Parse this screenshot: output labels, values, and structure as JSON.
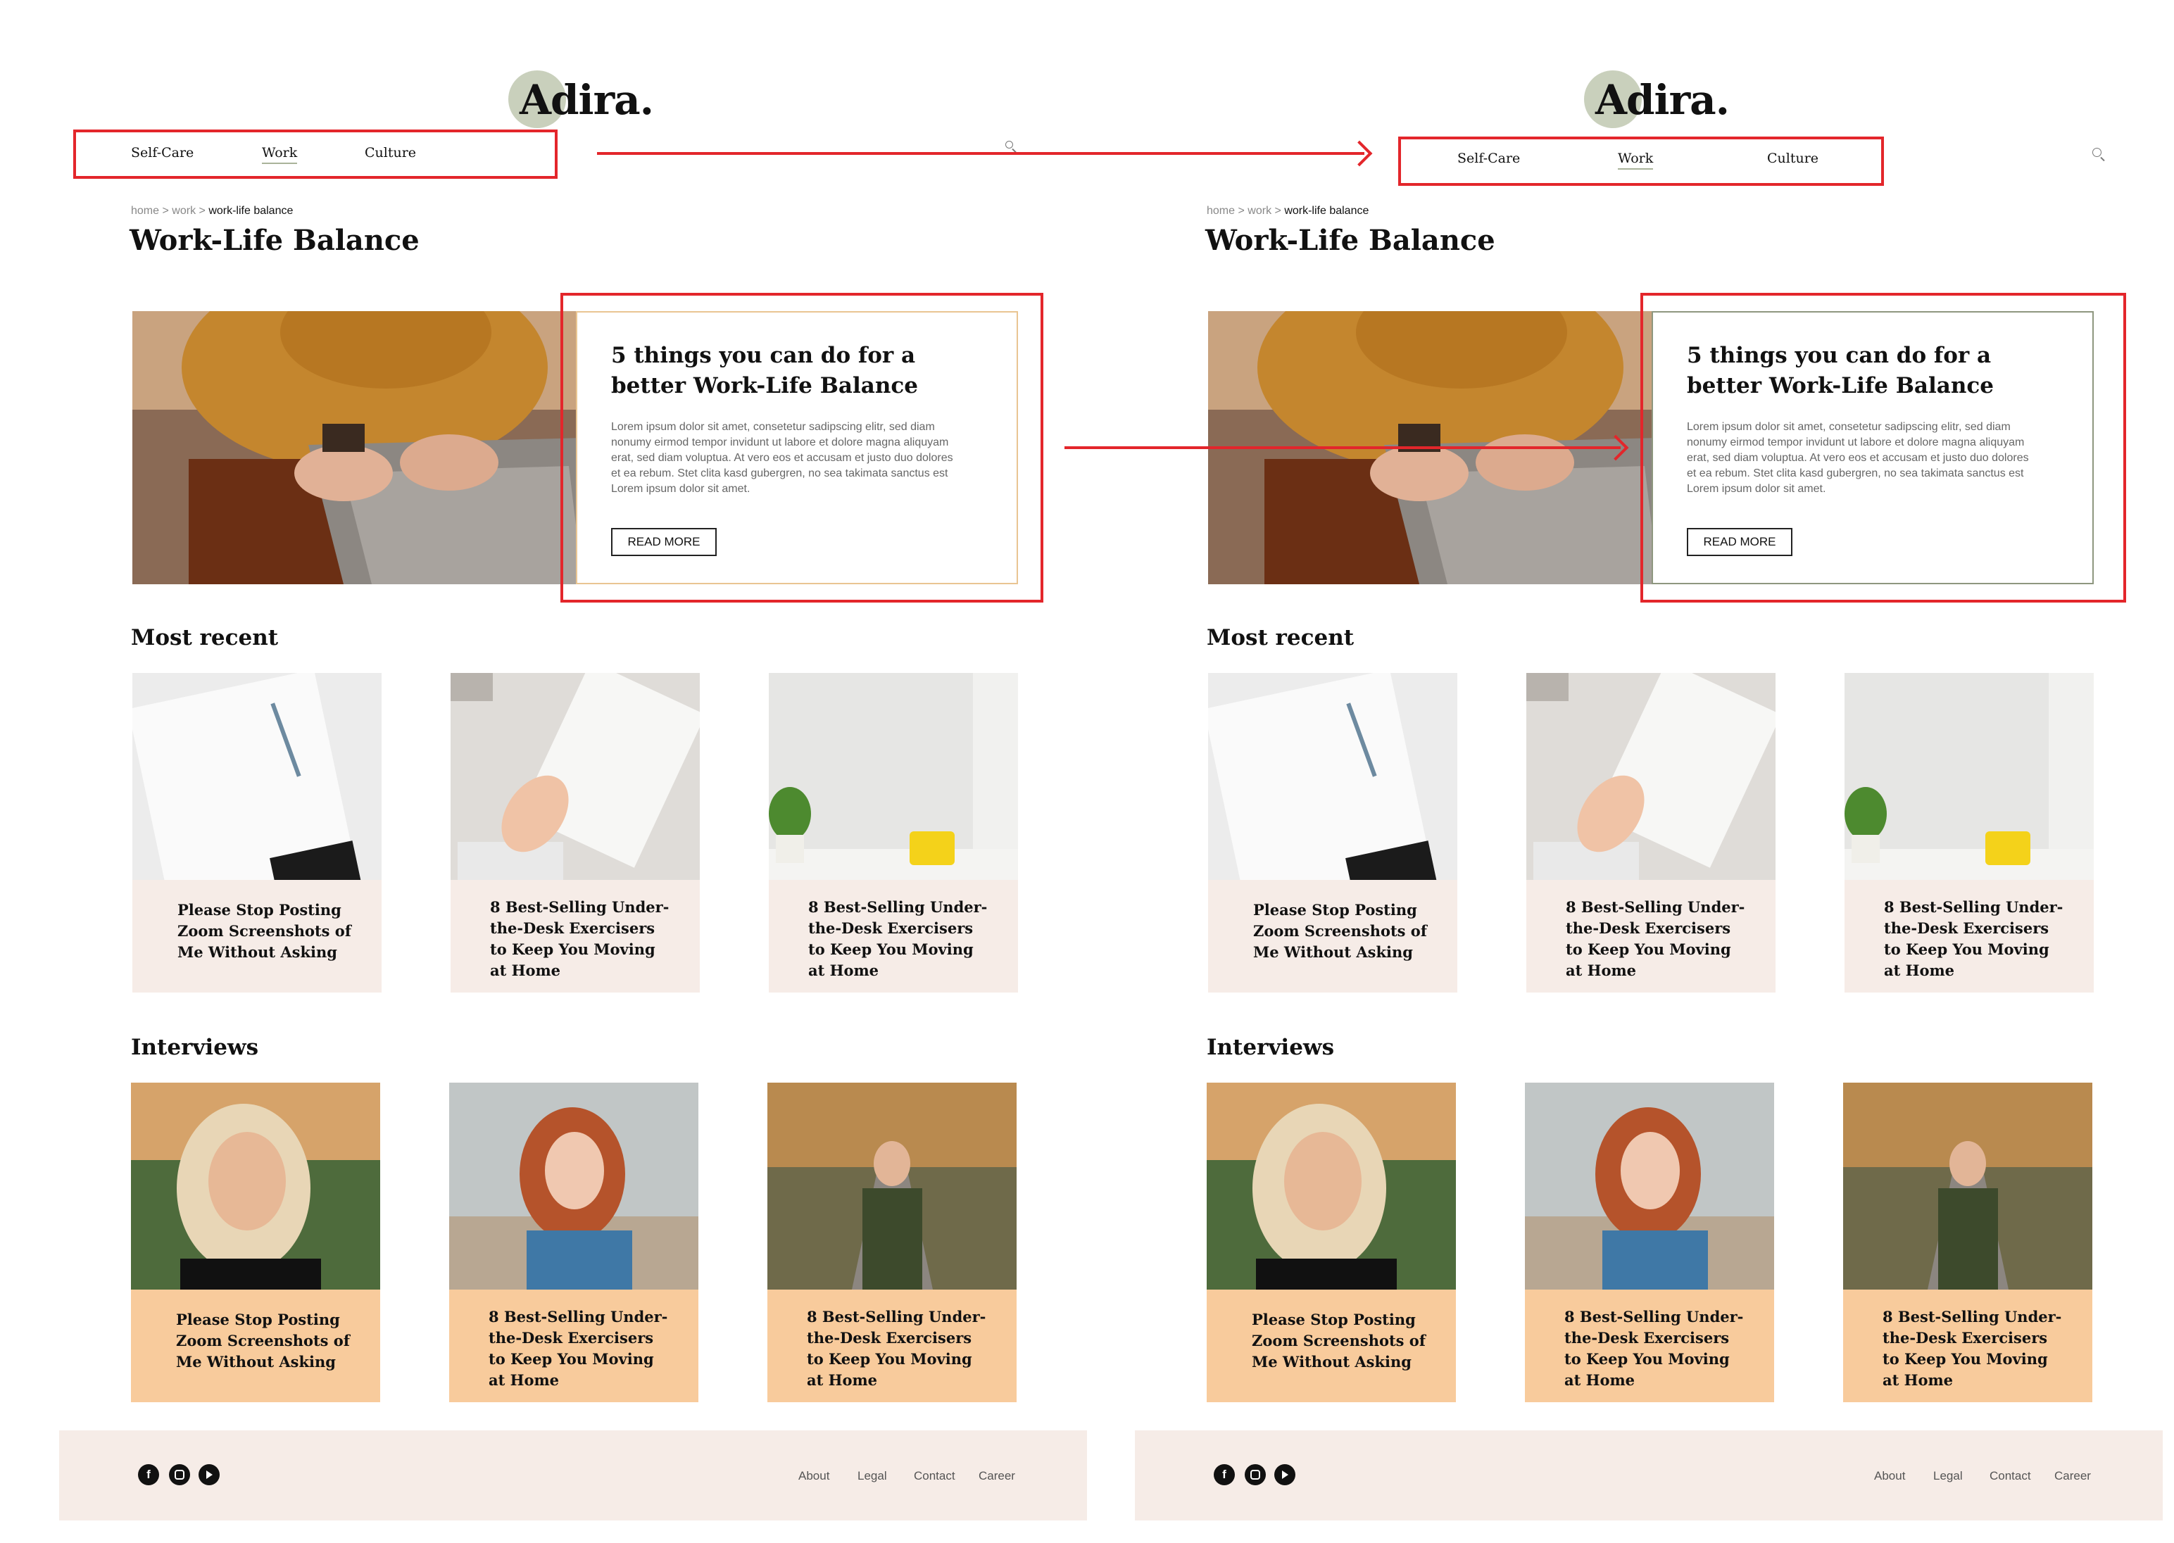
{
  "brand": {
    "logo": "Adira."
  },
  "nav": {
    "items": [
      "Self-Care",
      "Work",
      "Culture"
    ],
    "active": "Work"
  },
  "breadcrumb": {
    "home": "home",
    "sep": ">",
    "parent": "work",
    "current": "work-life balance"
  },
  "page": {
    "title": "Work-Life Balance"
  },
  "hero": {
    "title": "5 things you can do for a better Work-Life Balance",
    "body": "Lorem ipsum dolor sit amet, consetetur sadipscing elitr, sed diam nonumy eirmod tempor invidunt ut labore et dolore magna aliquyam erat, sed diam voluptua. At vero eos et accusam et justo duo dolores et ea rebum. Stet clita kasd gubergren, no sea takimata sanctus est Lorem ipsum dolor sit amet.",
    "button": "READ MORE"
  },
  "most_recent": {
    "title": "Most recent",
    "cards": [
      {
        "title": "Please Stop Posting Zoom Screenshots of Me Without Asking"
      },
      {
        "title": "8 Best-Selling Under-the-Desk Exercisers to Keep You Moving at Home"
      },
      {
        "title": "8 Best-Selling Under-the-Desk Exercisers to Keep You Moving at Home"
      }
    ]
  },
  "interviews": {
    "title": "Interviews",
    "cards": [
      {
        "title": "Please Stop Posting Zoom Screenshots of Me Without Asking"
      },
      {
        "title": "8 Best-Selling Under-the-Desk Exercisers to Keep You Moving at Home"
      },
      {
        "title": "8 Best-Selling Under-the-Desk Exercisers to Keep You Moving at Home"
      }
    ]
  },
  "footer": {
    "social": [
      "facebook-icon",
      "instagram-icon",
      "youtube-icon"
    ],
    "links": [
      "About",
      "Legal",
      "Contact",
      "Career"
    ]
  },
  "colors": {
    "accent_green": "#c9d0bc",
    "card_beige": "#f6ece7",
    "card_peach": "#f8cb9c",
    "hero_border_v1": "#e9c592",
    "hero_border_v2": "#8e977f",
    "annotation_red": "#e3262b"
  }
}
